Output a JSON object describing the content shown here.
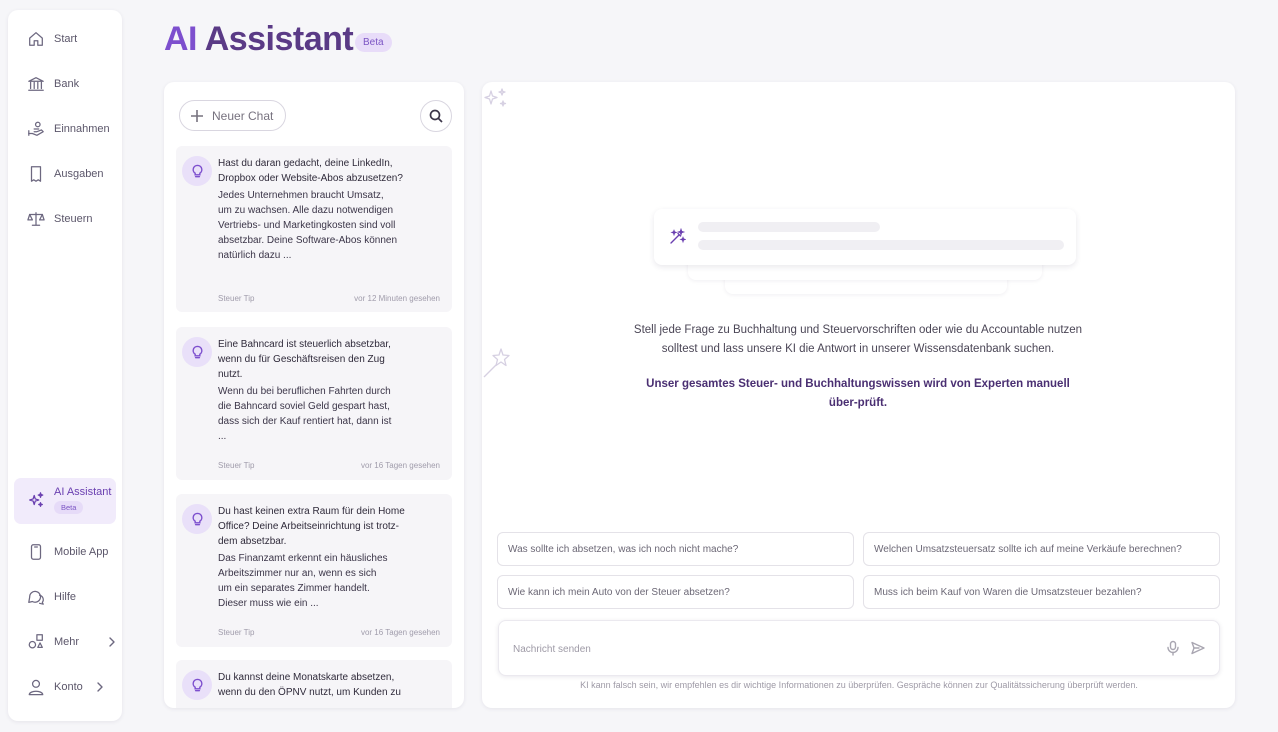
{
  "sidebar": {
    "items": [
      {
        "label": "Start",
        "icon": "home-icon"
      },
      {
        "label": "Bank",
        "icon": "bank-icon"
      },
      {
        "label": "Einnahmen",
        "icon": "income-icon"
      },
      {
        "label": "Ausgaben",
        "icon": "receipt-icon"
      },
      {
        "label": "Steuern",
        "icon": "scale-icon"
      },
      {
        "label": "AI Assistant",
        "icon": "sparkles-icon",
        "badge": "Beta",
        "active": true
      },
      {
        "label": "Mobile App",
        "icon": "phone-icon"
      },
      {
        "label": "Hilfe",
        "icon": "chat-bubbles-icon"
      },
      {
        "label": "Mehr",
        "icon": "shapes-icon"
      },
      {
        "label": "Konto",
        "icon": "user-icon"
      }
    ]
  },
  "header": {
    "title_prefix": "AI",
    "title_rest": "Assistant",
    "badge": "Beta"
  },
  "chat_list": {
    "new_chat_label": "Neuer Chat",
    "tips": [
      {
        "title": "Hast du daran gedacht, deine LinkedIn, Dropbox oder Website-Abos abzusetzen?",
        "body": "Jedes Unternehmen braucht Umsatz, um zu wachsen. Alle dazu notwendigen Vertriebs- und Marketingkosten sind voll absetzbar. Deine Software-Abos können natürlich dazu ...",
        "tag": "Steuer Tip",
        "time": "vor 12 Minuten gesehen"
      },
      {
        "title": "Eine Bahncard ist steuerlich absetzbar, wenn du für Geschäftsreisen den Zug nutzt.",
        "body": "Wenn du bei beruflichen Fahrten durch die Bahncard soviel Geld gespart hast, dass sich der Kauf rentiert hat, dann ist ...",
        "tag": "Steuer Tip",
        "time": "vor 16 Tagen gesehen"
      },
      {
        "title": "Du hast keinen extra Raum für dein Home Office? Deine Arbeitseinrichtung ist trotz-dem absetzbar.",
        "body": "Das Finanzamt erkennt ein häusliches Arbeitszimmer nur an, wenn es sich um ein separates Zimmer handelt. Dieser muss wie ein ...",
        "tag": "Steuer Tip",
        "time": "vor 16 Tagen gesehen"
      },
      {
        "title": "Du kannst deine Monatskarte absetzen, wenn du den ÖPNV nutzt, um Kunden zu",
        "body": "",
        "tag": "",
        "time": ""
      }
    ]
  },
  "main": {
    "intro": "Stell jede Frage zu Buchhaltung und Steuervorschriften oder wie du Accountable nutzen solltest und lass unsere KI die Antwort in unserer Wissensdatenbank suchen.",
    "intro_strong": "Unser gesamtes Steuer- und Buchhaltungswissen wird von Experten manuell über-prüft.",
    "suggestions": [
      "Was sollte ich absetzen, was ich noch nicht mache?",
      "Welchen Umsatzsteuersatz sollte ich auf meine Verkäufe berechnen?",
      "Wie kann ich mein Auto von der Steuer absetzen?",
      "Muss ich beim Kauf von Waren die Umsatzsteuer bezahlen?"
    ],
    "message_placeholder": "Nachricht senden",
    "message_value": "",
    "disclaimer": "KI kann falsch sein, wir empfehlen es dir wichtige Informationen zu überprüfen. Gespräche können zur Qualitätssicherung überprüft werden."
  },
  "colors": {
    "accent": "#7d4fce",
    "title": "#5a3a86",
    "active_bg": "#f1ebfb",
    "card_bg": "#f6f5f8"
  }
}
